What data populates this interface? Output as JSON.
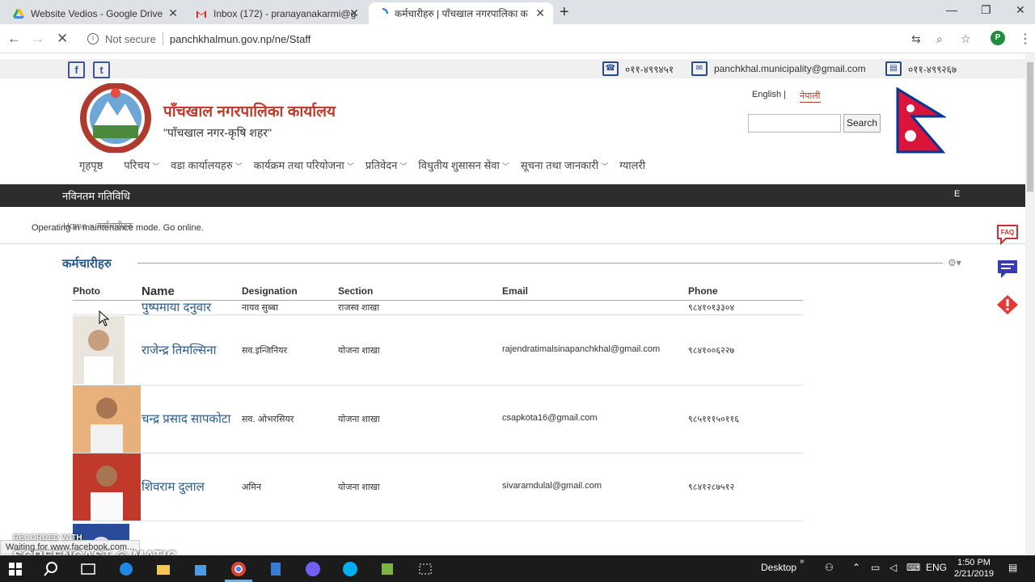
{
  "browser": {
    "tabs": [
      {
        "title": "Website Vedios - Google Drive",
        "icon": "google-drive-icon"
      },
      {
        "title": "Inbox (172) - pranayanakarmi@g",
        "icon": "gmail-icon"
      },
      {
        "title": "कर्मचारीहरु | पाँचखाल नगरपालिका क",
        "icon": "loading-icon"
      }
    ],
    "new_tab": "+",
    "minimize": "—",
    "restore": "❐",
    "close": "✕",
    "not_secure": "Not secure",
    "url": "panchkhalmun.gov.np/ne/Staff",
    "profile_initial": "P"
  },
  "site": {
    "phone1": "०११-४९९४५१",
    "email": "panchkhal.municipality@gmail.com",
    "phone2": "०११-४९९२६७",
    "title": "पाँचखाल नगरपालिका कार्यालय",
    "slogan": "\"पाँचखाल नगर-कृषि शहर\"",
    "lang_english": "English |",
    "lang_nepali": "नेपाली",
    "search_label": "Search",
    "nav": [
      {
        "label": "गृहपृष्ठ",
        "dropdown": false
      },
      {
        "label": "परिचय",
        "dropdown": true
      },
      {
        "label": "वडा कार्यालयहरु",
        "dropdown": true
      },
      {
        "label": "कार्यक्रम तथा परियोजना",
        "dropdown": true
      },
      {
        "label": "प्रतिवेदन",
        "dropdown": true
      },
      {
        "label": "विधुतीय शुसासन सेवा",
        "dropdown": true
      },
      {
        "label": "सूचना तथा जानकारी",
        "dropdown": true
      },
      {
        "label": "ग्यालरी",
        "dropdown": false
      }
    ],
    "news_label": "नविनतम गतिविधि",
    "news_ticker": "E",
    "breadcrumb": "Home » कर्मचारीहरु",
    "maintenance": "Operating in maintenance mode. Go online.",
    "section_title": "कर्मचारीहरु"
  },
  "staff_table": {
    "headers": {
      "photo": "Photo",
      "name": "Name",
      "designation": "Designation",
      "section": "Section",
      "email": "Email",
      "phone": "Phone"
    },
    "rows": [
      {
        "name": "पुष्पमाया दनुवार",
        "designation": "नायव सुब्बा",
        "section": "राजस्व शाखा",
        "email": "",
        "phone": "९८४१०१३३०४"
      },
      {
        "name": "राजेन्द्र तिमल्सिना",
        "designation": "सव.इन्जिनियर",
        "section": "योजना शाखा",
        "email": "rajendratimalsinapanchkhal@gmail.com",
        "phone": "९८४१००६२२७"
      },
      {
        "name": "चन्द्र प्रसाद सापकोटा",
        "designation": "सव. ओभरसियर",
        "section": "योजना शाखा",
        "email": "csapkota16@gmail.com",
        "phone": "९८५१११५०११६"
      },
      {
        "name": "शिवराम दुलाल",
        "designation": "अमिन",
        "section": "योजना शाखा",
        "email": "sivaramdulal@gmail.com",
        "phone": "९८४१२८७५१२"
      }
    ]
  },
  "side_tabs": {
    "faq": "FAQ"
  },
  "status_bar": "Waiting for www.facebook.com...",
  "watermark": {
    "line1": "RECORDED WITH",
    "line2": "SCREENCAST ◎ MATIC"
  },
  "taskbar": {
    "desktop": "Desktop",
    "lang": "ENG",
    "time": "1:50 PM",
    "date": "2/21/2019"
  }
}
